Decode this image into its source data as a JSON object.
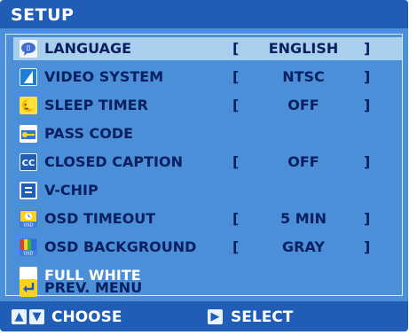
{
  "header": {
    "title": "SETUP"
  },
  "menu": {
    "items": [
      {
        "label": "LANGUAGE",
        "value": "ENGLISH",
        "icon": "language-icon"
      },
      {
        "label": "VIDEO SYSTEM",
        "value": "NTSC",
        "icon": "video-system-icon"
      },
      {
        "label": "SLEEP TIMER",
        "value": "OFF",
        "icon": "sleep-timer-icon"
      },
      {
        "label": "PASS CODE",
        "icon": "pass-code-icon"
      },
      {
        "label": "CLOSED CAPTION",
        "value": "OFF",
        "icon": "closed-caption-icon"
      },
      {
        "label": "V-CHIP",
        "icon": "v-chip-icon"
      },
      {
        "label": "OSD TIMEOUT",
        "value": "5 MIN",
        "icon": "osd-timeout-icon"
      },
      {
        "label": "OSD BACKGROUND",
        "value": "GRAY",
        "icon": "osd-background-icon"
      },
      {
        "label": "FULL WHITE",
        "icon": "full-white-icon"
      },
      {
        "label": "PREV. MENU",
        "icon": "prev-menu-icon"
      }
    ],
    "bracket_open": "[",
    "bracket_close": "]"
  },
  "footer": {
    "choose_label": "CHOOSE",
    "select_label": "SELECT",
    "up_icon": "arrow-up-icon",
    "down_icon": "arrow-down-icon",
    "select_icon": "arrow-right-icon"
  },
  "colors": {
    "background": "#4a8fd7",
    "header": "#1f5db6",
    "highlight": "#a9cfee",
    "text": "#0a1f5f"
  }
}
